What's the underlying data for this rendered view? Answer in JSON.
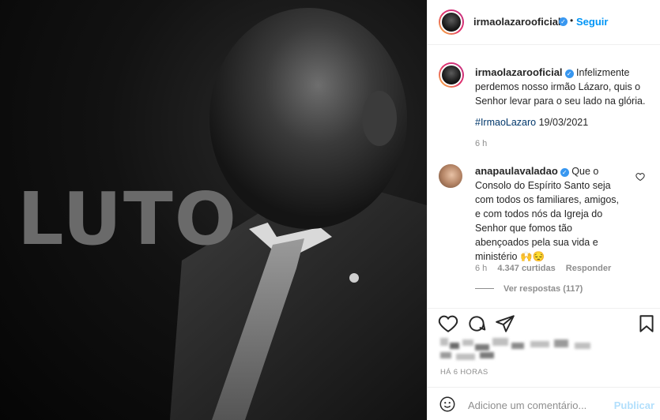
{
  "post": {
    "overlay_text": "LUTO"
  },
  "header": {
    "username": "irmaolazarooficial",
    "verified_mark": "✓",
    "dot": "•",
    "follow_label": "Seguir"
  },
  "caption": {
    "username": "irmaolazarooficial",
    "text": "Infelizmente perdemos nosso irmão Lázaro, quis o Senhor levar para o seu lado na glória.",
    "hashtag": "#IrmaoLazaro",
    "date": "19/03/2021",
    "time": "6 h"
  },
  "comment": {
    "username": "anapaulavaladao",
    "text": "Que o Consolo do Espírito Santo seja com todos os familiares, amigos, e com todos nós da Igreja do Senhor que fomos tão abençoados pela sua vida e ministério",
    "emoji": "🙌😔",
    "time": "6 h",
    "likes": "4.347 curtidas",
    "reply_label": "Responder",
    "view_replies": "Ver respostas (117)"
  },
  "actions": {
    "time_ago": "HÁ 6 HORAS"
  },
  "add_comment": {
    "placeholder": "Adicione um comentário...",
    "post_label": "Publicar"
  }
}
